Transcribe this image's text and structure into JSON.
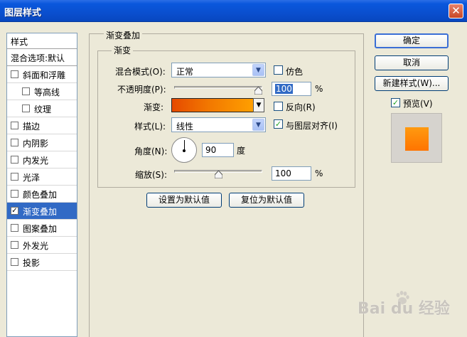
{
  "window": {
    "title": "图层样式"
  },
  "styles_list": {
    "header": "样式",
    "blend_options": "混合选项:默认",
    "items": [
      {
        "label": "斜面和浮雕",
        "checked": false,
        "sub": false
      },
      {
        "label": "等高线",
        "checked": false,
        "sub": true
      },
      {
        "label": "纹理",
        "checked": false,
        "sub": true
      },
      {
        "label": "描边",
        "checked": false,
        "sub": false
      },
      {
        "label": "内阴影",
        "checked": false,
        "sub": false
      },
      {
        "label": "内发光",
        "checked": false,
        "sub": false
      },
      {
        "label": "光泽",
        "checked": false,
        "sub": false
      },
      {
        "label": "颜色叠加",
        "checked": false,
        "sub": false
      },
      {
        "label": "渐变叠加",
        "checked": true,
        "sub": false,
        "active": true
      },
      {
        "label": "图案叠加",
        "checked": false,
        "sub": false
      },
      {
        "label": "外发光",
        "checked": false,
        "sub": false
      },
      {
        "label": "投影",
        "checked": false,
        "sub": false
      }
    ]
  },
  "panel": {
    "group_title": "渐变叠加",
    "subgroup_title": "渐变",
    "blend_mode": {
      "label": "混合模式(O):",
      "value": "正常"
    },
    "dither": {
      "label": "仿色",
      "checked": false
    },
    "opacity": {
      "label": "不透明度(P):",
      "value": "100",
      "unit": "%",
      "level": 1.0
    },
    "gradient": {
      "label": "渐变:",
      "colors": [
        "#e64a00",
        "#f27800",
        "#ffa000"
      ]
    },
    "reverse": {
      "label": "反向(R)",
      "checked": false
    },
    "style": {
      "label": "样式(L):",
      "value": "线性"
    },
    "align": {
      "label": "与图层对齐(I)",
      "checked": true
    },
    "angle": {
      "label": "角度(N):",
      "value": "90",
      "unit": "度"
    },
    "scale": {
      "label": "缩放(S):",
      "value": "100",
      "unit": "%",
      "level": 0.5
    },
    "set_default": "设置为默认值",
    "reset_default": "复位为默认值"
  },
  "buttons": {
    "ok": "确定",
    "cancel": "取消",
    "new_style": "新建样式(W)...",
    "preview": {
      "label": "预览(V)",
      "checked": true
    }
  },
  "preview_color": "#ff8a08",
  "watermark": "Bai du 经验"
}
